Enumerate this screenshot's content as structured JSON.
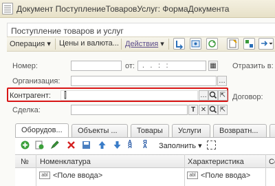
{
  "window": {
    "title": "Документ ПоступлениеТоваровУслуг: ФормаДокумента"
  },
  "form": {
    "title": "Поступление товаров и услуг"
  },
  "toolbar": {
    "operation": "Операция",
    "prices": "Цены и валюта...",
    "actions": "Действия"
  },
  "fields": {
    "number_label": "Номер:",
    "from_label": "от:",
    "date_value": ". .   : :",
    "reflect_label": "Отразить в:",
    "org_label": "Организация:",
    "counterparty_label": "Контрагент:",
    "contract_label": "Договор:",
    "deal_label": "Сделка:"
  },
  "tabs": [
    {
      "label": "Оборудов..."
    },
    {
      "label": "Объекты ..."
    },
    {
      "label": "Товары"
    },
    {
      "label": "Услуги"
    },
    {
      "label": "Возвратн..."
    }
  ],
  "table_toolbar": {
    "fill_label": "Заполнить"
  },
  "table": {
    "columns": [
      "№",
      "Номенклатура",
      "Характеристика",
      "Се"
    ],
    "rows": [
      {
        "nomenclature": "<Поле ввода>",
        "characteristic": "<Поле ввода>"
      }
    ],
    "abl_badge": "abl"
  }
}
